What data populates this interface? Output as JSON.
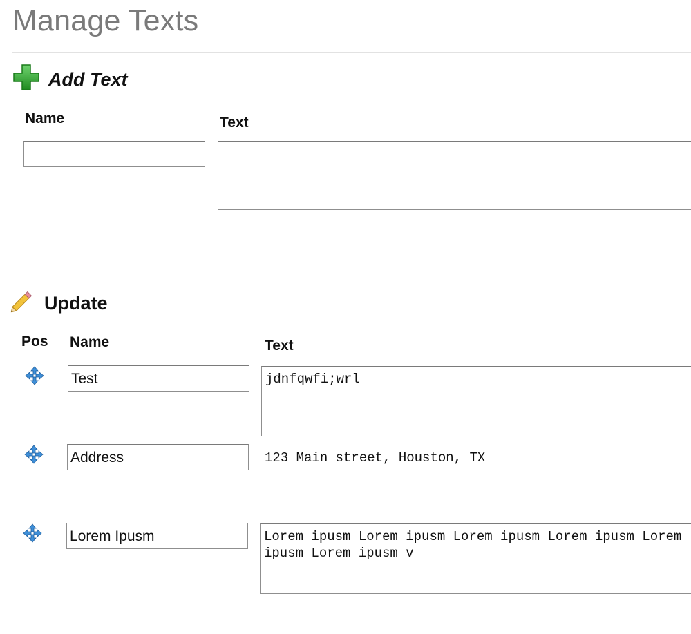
{
  "page": {
    "title": "Manage Texts"
  },
  "add_section": {
    "title": "Add Text",
    "name_label": "Name",
    "text_label": "Text",
    "name_value": "",
    "text_value": ""
  },
  "update_section": {
    "title": "Update",
    "pos_label": "Pos",
    "name_label": "Name",
    "text_label": "Text",
    "rows": [
      {
        "name": "Test",
        "text": "jdnfqwfi;wrl"
      },
      {
        "name": "Address",
        "text": "123 Main street, Houston, TX"
      },
      {
        "name": "Lorem Ipusm",
        "text": "Lorem ipusm Lorem ipusm Lorem ipusm Lorem ipusm Lorem ipusm Lorem ipusm v"
      }
    ]
  },
  "icons": {
    "add": "plus-icon",
    "update": "pencil-icon",
    "move": "move-arrows-icon"
  },
  "colors": {
    "title_gray": "#7a7a7a",
    "plus_green": "#2ea32e",
    "move_blue": "#3f8fd8",
    "pencil_yellow": "#f2c33b"
  }
}
